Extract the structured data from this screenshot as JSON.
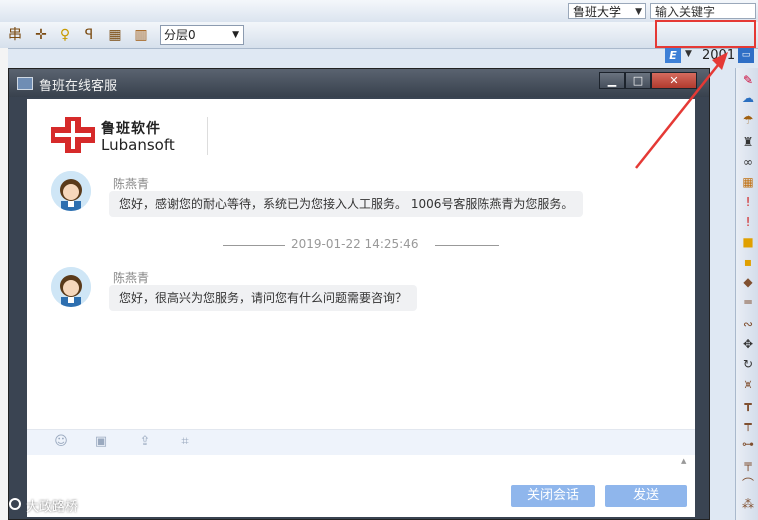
{
  "topbar": {
    "school_dropdown": "鲁班大学",
    "keyword_input": "输入关键字"
  },
  "toolbar": {
    "layer_select": "分层0",
    "e_button": "E",
    "value_2001": "2001"
  },
  "dialog": {
    "title": "鲁班在线客服",
    "logo_cn": "鲁班软件",
    "logo_en": "Lubansoft",
    "messages": [
      {
        "sender": "陈燕青",
        "text": "您好，感谢您的耐心等待，系统已为您接入人工服务。 1006号客服陈燕青为您服务。"
      },
      {
        "sender": "陈燕青",
        "text": "您好，很高兴为您服务，请问您有什么问题需要咨询？"
      }
    ],
    "timestamp": "2019-01-22 14:25:46",
    "close_button": "关闭会话",
    "send_button": "发送"
  },
  "watermark": "大政路桥",
  "colors": {
    "accent_button": "#8fb6ec",
    "highlight": "#e53935",
    "logo_red": "#d62a2a"
  }
}
